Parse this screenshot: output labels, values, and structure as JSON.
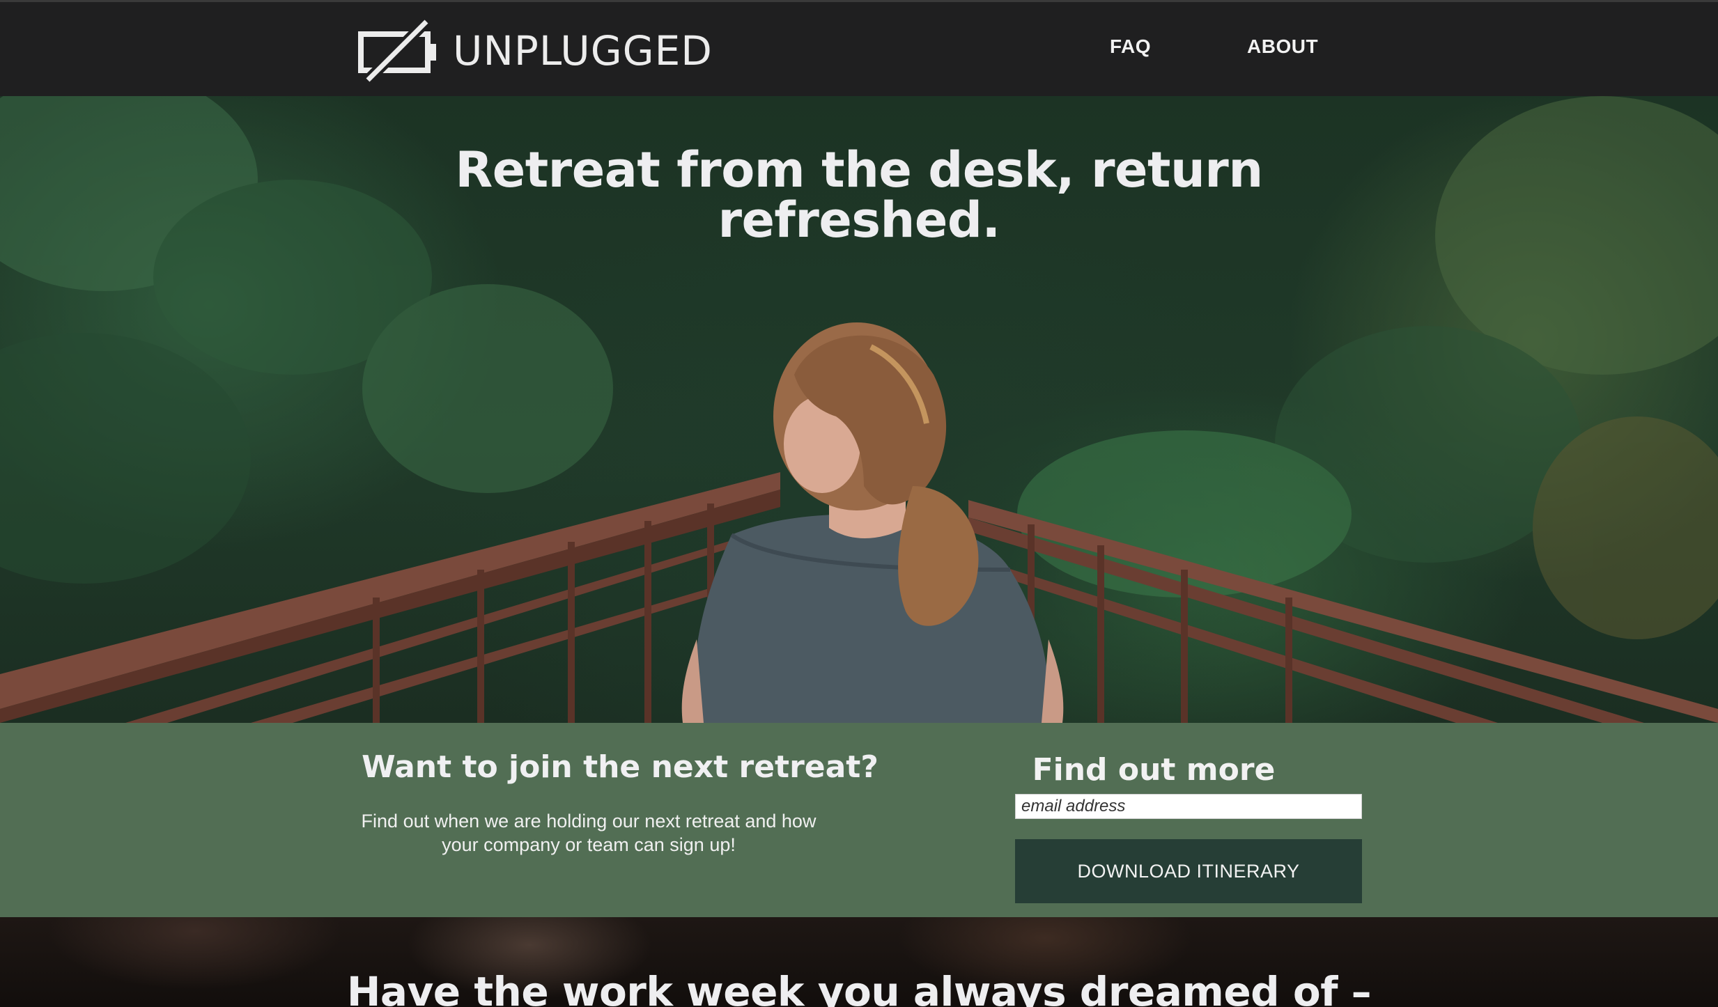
{
  "nav": {
    "brand": "UNPLUGGED",
    "logo_icon": "unplugged-battery-icon",
    "links": [
      {
        "label": "FAQ"
      },
      {
        "label": "ABOUT"
      }
    ]
  },
  "hero": {
    "title": "Retreat from the desk, return refreshed."
  },
  "signup": {
    "heading": "Want to join the next retreat?",
    "text": "Find out when we are holding our next retreat and how your company or team can sign up!",
    "findout_heading": "Find out more",
    "email_placeholder": "email address",
    "download_label": "DOWNLOAD ITINERARY"
  },
  "bottom": {
    "title": "Have the work week you always dreamed of –"
  },
  "colors": {
    "nav_bg": "#1f1f20",
    "signup_bg": "#526e54",
    "button_bg": "#263e36",
    "text_light": "#eeeef0"
  }
}
